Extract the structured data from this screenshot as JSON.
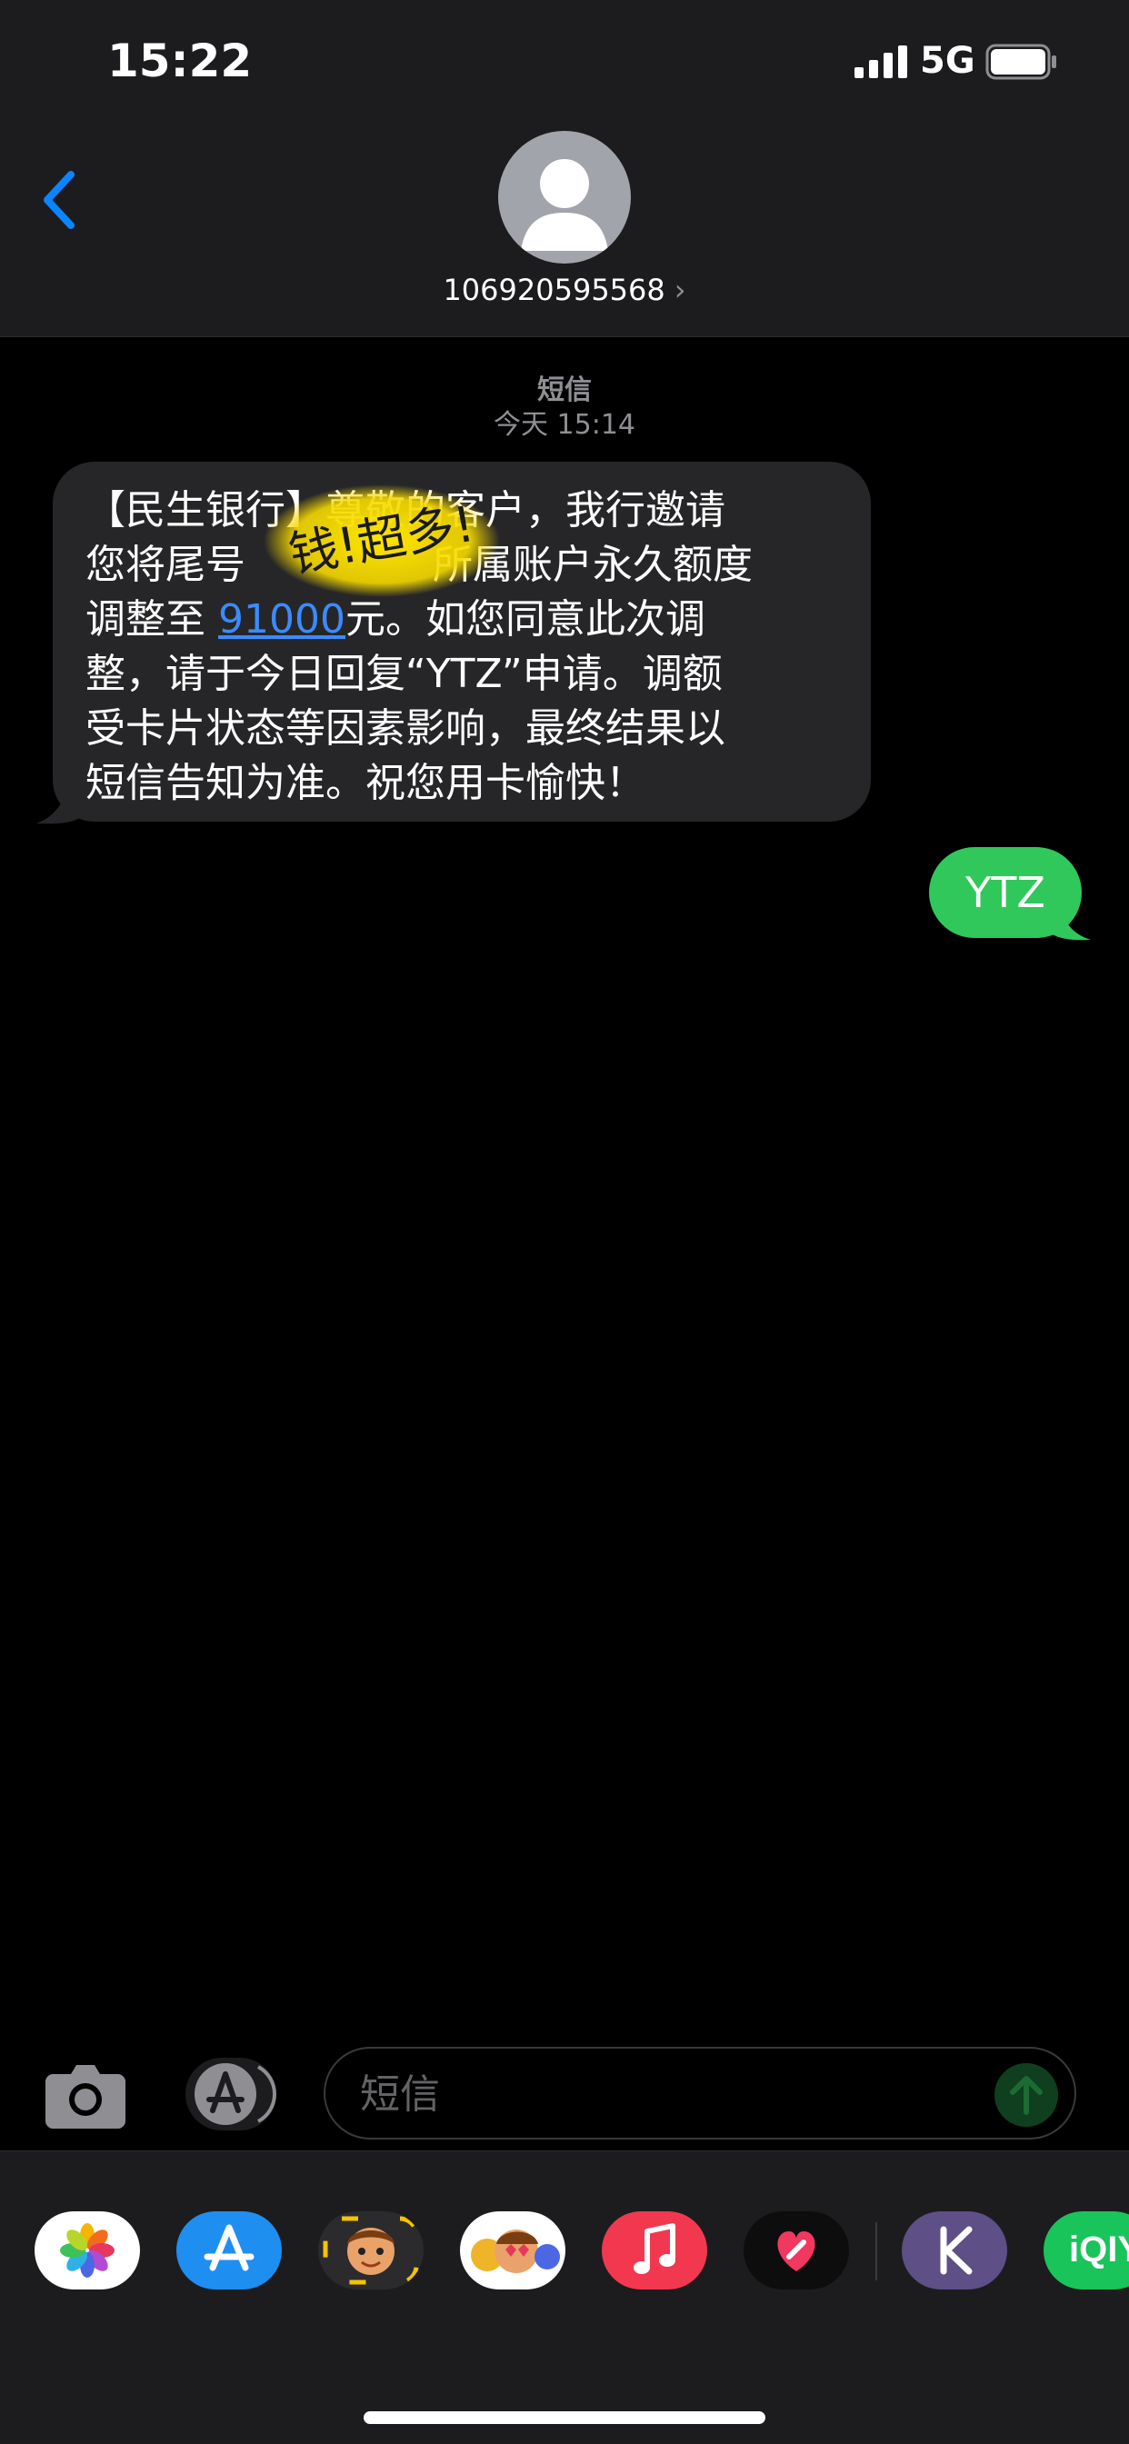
{
  "status_bar": {
    "time": "15:22",
    "network": "5G"
  },
  "header": {
    "contact": "106920595568",
    "chevron": "›"
  },
  "conversation": {
    "service_label": "短信",
    "timestamp": "今天 15:14",
    "incoming": {
      "lines": [
        "【民生银行】尊敬的客户，我行邀请",
        "您将尾号",
        "所属账户永久额度",
        "调整至",
        "91000",
        "元。如您同意此次调",
        "整，请于今日回复“YTZ”申请。调额",
        "受卡片状态等因素影响，最终结果以",
        "短信告知为准。祝您用卡愉快！"
      ]
    },
    "scribble_text": "钱!超多!",
    "outgoing": {
      "text": "YTZ"
    }
  },
  "input_bar": {
    "placeholder": "短信"
  },
  "app_drawer": {
    "apps": [
      "photos-icon",
      "app-store-icon",
      "memoji-icon",
      "animoji-icon",
      "music-icon",
      "digital-touch-icon",
      "k-app-icon",
      "iqiyi-icon"
    ],
    "iqiyi_label": "iQIY"
  },
  "colors": {
    "incoming_bubble": "#262628",
    "outgoing_bubble": "#30c85a",
    "link": "#3b8bff",
    "header_bg": "#1c1c1e",
    "accent": "#0a84ff"
  }
}
